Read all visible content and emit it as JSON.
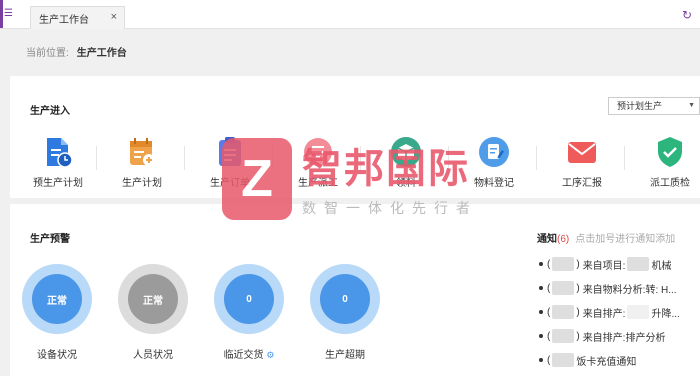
{
  "tabbar": {
    "active_tab": "生产工作台",
    "close_glyph": "×",
    "menu_glyph": "☰",
    "refresh_glyph": "↻"
  },
  "breadcrumb": {
    "label": "当前位置:",
    "current": "生产工作台"
  },
  "entry_section": {
    "title": "生产进入",
    "plan_select": {
      "value": "预计划生产",
      "arrow": "▼"
    },
    "items": [
      {
        "label": "预生产计划",
        "icon": "document-clock-icon",
        "color": "#2f7ae0"
      },
      {
        "label": "生产计划",
        "icon": "calendar-plus-icon",
        "color": "#f0a24b"
      },
      {
        "label": "生产订单",
        "icon": "clipboard-icon",
        "color": "#5a7bea"
      },
      {
        "label": "生产派工",
        "icon": "dispatch-icon",
        "color": "#f28c98"
      },
      {
        "label": "领料",
        "icon": "box-icon",
        "color": "#3aa88b"
      },
      {
        "label": "物料登记",
        "icon": "edit-doc-icon",
        "color": "#4f9ce8"
      },
      {
        "label": "工序汇报",
        "icon": "mail-icon",
        "color": "#ef5b5b"
      },
      {
        "label": "派工质检",
        "icon": "shield-check-icon",
        "color": "#2cb57d"
      }
    ]
  },
  "warning_section": {
    "title": "生产预警",
    "gauges": [
      {
        "label": "设备状况",
        "value": "正常",
        "ring": "#b8d9f7",
        "core": "#4a96e8"
      },
      {
        "label": "人员状况",
        "value": "正常",
        "ring": "#dcdcdc",
        "core": "#9b9b9b"
      },
      {
        "label": "临近交货",
        "value": "0",
        "ring": "#b8d9f7",
        "core": "#4a96e8"
      },
      {
        "label": "生产超期",
        "value": "0",
        "ring": "#b8d9f7",
        "core": "#4a96e8"
      }
    ]
  },
  "notice": {
    "title": "通知",
    "count": "(6)",
    "hint": "点击加号进行通知添加",
    "items": [
      {
        "open": "(",
        "close": ")",
        "prefix": "来自项目:",
        "text": "机械"
      },
      {
        "open": "(",
        "close": ")",
        "prefix": "来自物料分析:",
        "text": "转: H..."
      },
      {
        "open": "(",
        "close": ")",
        "prefix": "来自排产:",
        "text": "升降..."
      },
      {
        "open": "(",
        "close": ")",
        "prefix": "来自排产:",
        "text": "排产分析"
      },
      {
        "open": "(",
        "close": "",
        "prefix": "",
        "text": "饭卡充值通知"
      }
    ]
  },
  "watermark": {
    "logo_letter": "Z",
    "title": "智邦国际",
    "subtitle": "数智一体化先行者"
  }
}
